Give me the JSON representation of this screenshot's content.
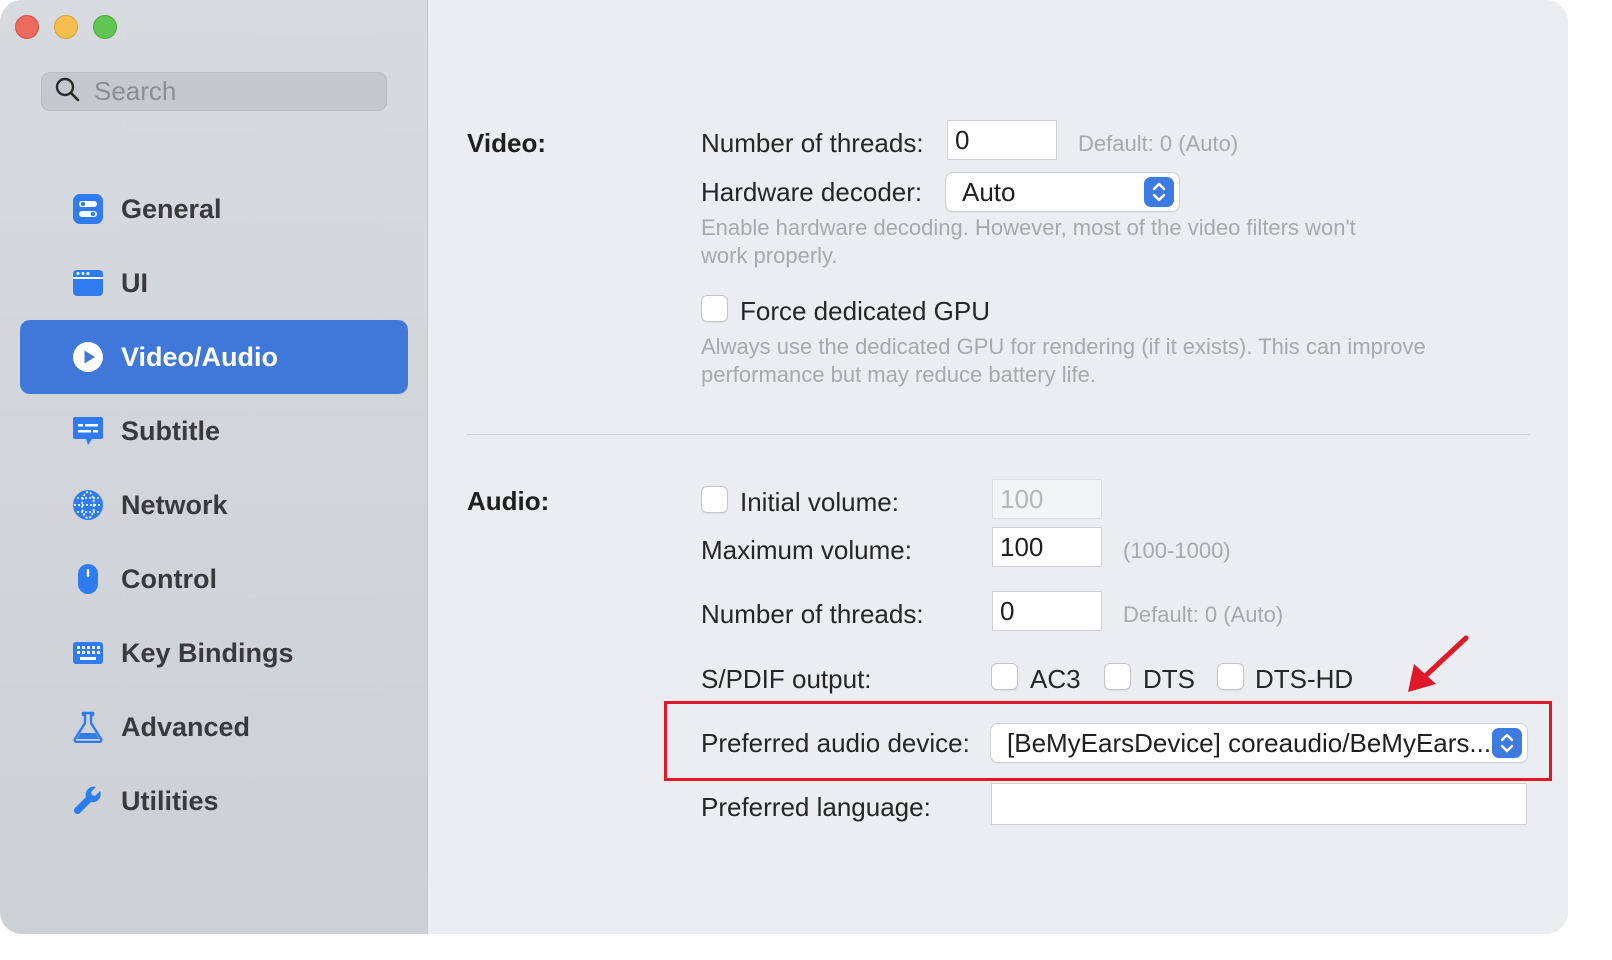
{
  "sidebar": {
    "search_placeholder": "Search",
    "items": [
      {
        "label": "General",
        "icon": "toggles-icon",
        "active": false
      },
      {
        "label": "UI",
        "icon": "window-icon",
        "active": false
      },
      {
        "label": "Video/Audio",
        "icon": "play-circle-icon",
        "active": true
      },
      {
        "label": "Subtitle",
        "icon": "caption-bubble-icon",
        "active": false
      },
      {
        "label": "Network",
        "icon": "globe-icon",
        "active": false
      },
      {
        "label": "Control",
        "icon": "mouse-icon",
        "active": false
      },
      {
        "label": "Key Bindings",
        "icon": "keyboard-icon",
        "active": false
      },
      {
        "label": "Advanced",
        "icon": "flask-icon",
        "active": false
      },
      {
        "label": "Utilities",
        "icon": "wrench-icon",
        "active": false
      }
    ]
  },
  "video": {
    "title": "Video:",
    "threads_label": "Number of threads:",
    "threads_value": "0",
    "threads_hint": "Default: 0 (Auto)",
    "hw_decoder_label": "Hardware decoder:",
    "hw_decoder_value": "Auto",
    "hw_decoder_hint_line1": "Enable hardware decoding. However, most of the video filters won't",
    "hw_decoder_hint_line2": "work properly.",
    "force_gpu_label": "Force dedicated GPU",
    "force_gpu_checked": false,
    "force_gpu_hint_line1": "Always use the dedicated GPU for rendering (if it exists). This can improve",
    "force_gpu_hint_line2": "performance but may reduce battery life."
  },
  "audio": {
    "title": "Audio:",
    "initial_volume_label": "Initial volume:",
    "initial_volume_checked": false,
    "initial_volume_value": "100",
    "max_volume_label": "Maximum volume:",
    "max_volume_value": "100",
    "max_volume_hint": "(100-1000)",
    "threads_label": "Number of threads:",
    "threads_value": "0",
    "threads_hint": "Default: 0 (Auto)",
    "spdif_label": "S/PDIF output:",
    "spdif_options": [
      {
        "label": "AC3",
        "checked": false
      },
      {
        "label": "DTS",
        "checked": false
      },
      {
        "label": "DTS-HD",
        "checked": false
      }
    ],
    "device_label": "Preferred audio device:",
    "device_value": "[BeMyEarsDevice] coreaudio/BeMyEars...",
    "language_label": "Preferred language:",
    "language_value": ""
  },
  "colors": {
    "accent": "#3f78d8",
    "icon_blue": "#2f7bf0",
    "annotation_red": "#e0192a"
  }
}
